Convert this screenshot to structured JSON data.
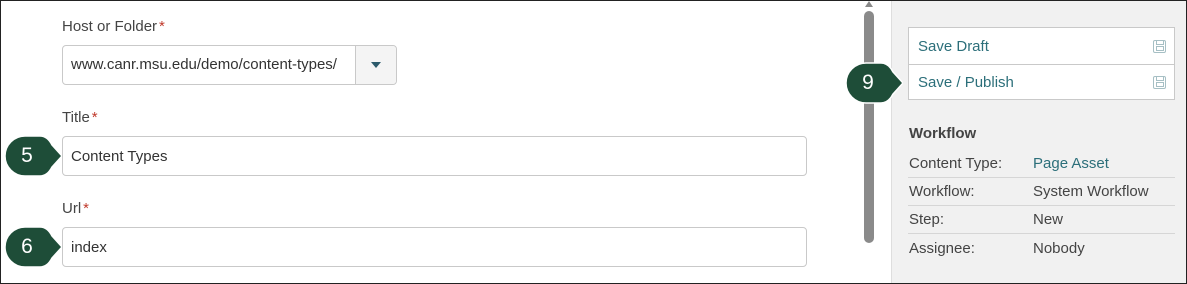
{
  "form": {
    "host": {
      "label": "Host or Folder",
      "required_mark": "*",
      "value": "www.canr.msu.edu/demo/content-types/"
    },
    "title": {
      "label": "Title",
      "required_mark": "*",
      "value": "Content Types"
    },
    "url": {
      "label": "Url",
      "required_mark": "*",
      "value": "index"
    }
  },
  "sidebar": {
    "save_draft_label": "Save Draft",
    "save_publish_label": "Save / Publish",
    "workflow": {
      "heading": "Workflow",
      "rows": [
        {
          "key": "Content Type:",
          "value": "Page Asset"
        },
        {
          "key": "Workflow:",
          "value": "System Workflow"
        },
        {
          "key": "Step:",
          "value": "New"
        },
        {
          "key": "Assignee:",
          "value": "Nobody"
        }
      ]
    }
  },
  "callouts": {
    "title": "5",
    "url": "6",
    "save_publish": "9"
  },
  "colors": {
    "callout_fill": "#1e4d38",
    "link": "#2c6f7a",
    "required": "#c0392b"
  }
}
